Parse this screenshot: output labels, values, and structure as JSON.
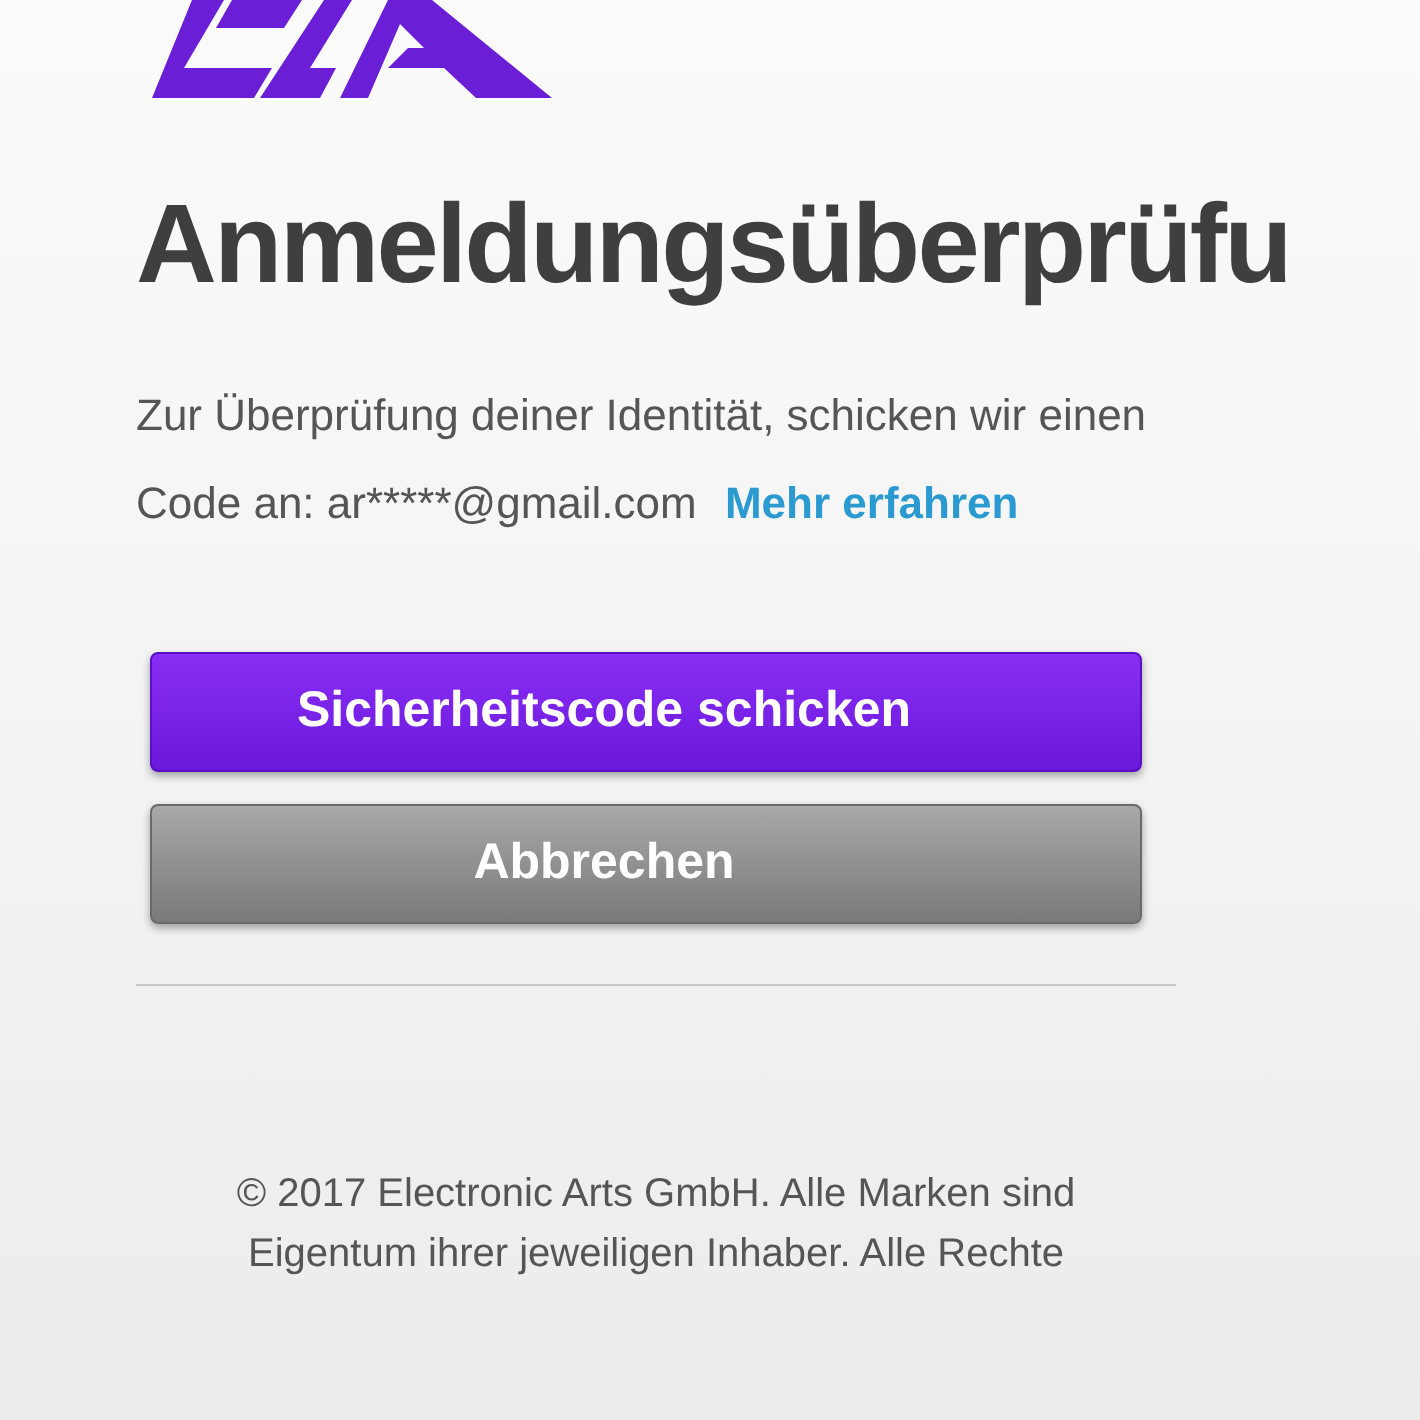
{
  "heading": "Anmeldungsüberprüfu",
  "message": {
    "text": "Zur Überprüfung deiner Identität, schicken wir einen Code an: ar*****@gmail.com",
    "link": "Mehr erfahren"
  },
  "buttons": [
    {
      "label": "Sicherheitscode schicken",
      "kind": "primary"
    },
    {
      "label": "Abbrechen",
      "kind": "secondary"
    }
  ],
  "footer": [
    "© 2017 Electronic Arts GmbH. Alle Marken sind",
    "Eigentum ihrer jeweiligen Inhaber. Alle Rechte"
  ]
}
